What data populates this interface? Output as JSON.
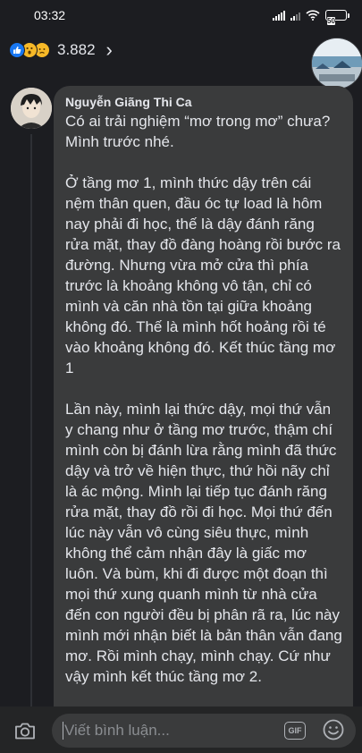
{
  "status_bar": {
    "time": "03:32",
    "battery": "50"
  },
  "reactions": {
    "count": "3.882",
    "icons": [
      "like-icon",
      "wow-icon",
      "sad-icon"
    ]
  },
  "comment": {
    "author": "Nguyễn Giãng Thi Ca",
    "text": "Có ai trải nghiệm “mơ trong mơ” chưa? Mình trước nhé.\n\nỞ tầng mơ 1, mình thức dậy trên cái nệm thân quen, đầu óc tự load là hôm nay phải đi học, thế là dậy đánh răng rửa mặt, thay đồ đàng hoàng rồi bước ra đường. Nhưng vừa mở cửa thì phía trước là khoảng không vô tận, chỉ có mình và căn nhà tồn tại giữa khoảng không đó. Thế là mình hốt hoảng rồi té vào khoảng không đó. Kết thúc tầng mơ 1\n\nLần này, mình lại thức dậy, mọi thứ vẫn y chang như ở tầng mơ trước, thậm chí mình còn bị đánh lừa rằng mình đã thức dậy và trở về hiện thực, thứ hồi nãy chỉ là ác mộng. Mình lại tiếp tục đánh răng rửa mặt, thay đồ rồi đi học. Mọi thứ đến lúc này vẫn vô cùng siêu thực, mình không thể cảm nhận đây là giấc mơ luôn. Và bùm, khi đi được một đoạn thì mọi thứ xung quanh mình từ nhà cửa đến con người đều bị phân rã ra, lúc này mình mới nhận biết là bản thân vẫn đang mơ. Rồi mình chạy, mình chạy. Cứ như vậy mình kết thúc tầng mơ 2.\n\nLại một lần nữa, mình thức dậy, kí ức của tầng mơ trước vẫn còn in đậm và nó"
  },
  "composer": {
    "placeholder": "Viết bình luận...",
    "gif_label": "GIF"
  },
  "colors": {
    "background": "#1c1d21",
    "bubble": "#3a3b3c",
    "text": "#e4e6eb",
    "like_blue": "#1877f2",
    "reaction_yellow": "#f7b928"
  }
}
